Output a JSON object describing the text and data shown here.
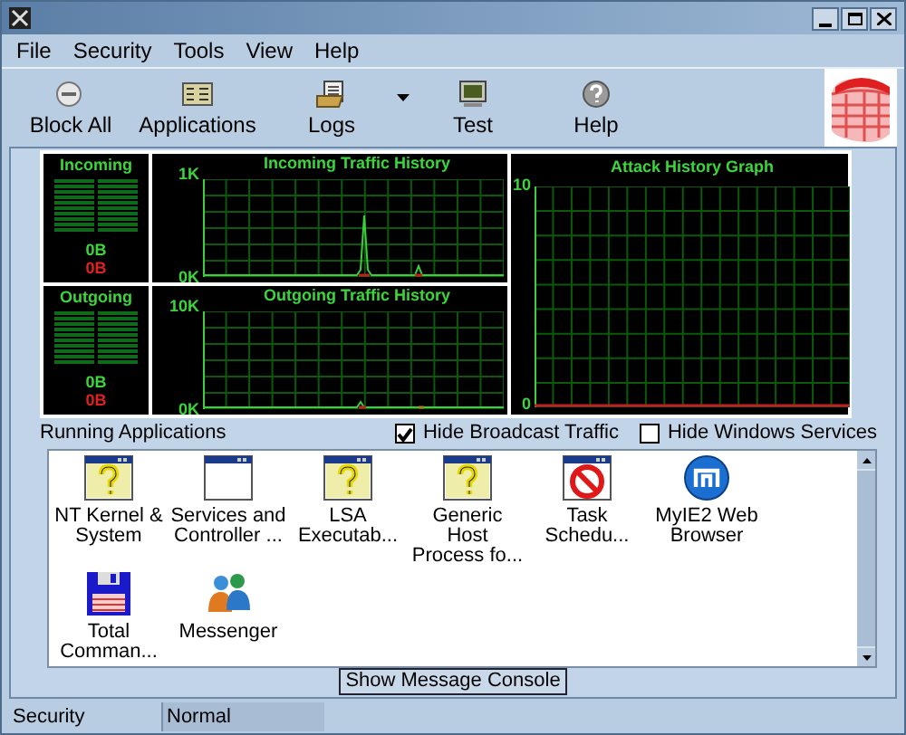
{
  "menu": [
    "File",
    "Security",
    "Tools",
    "View",
    "Help"
  ],
  "toolbar": [
    {
      "label": "Block All",
      "kind": "block",
      "has_menu": false
    },
    {
      "label": "Applications",
      "kind": "apps",
      "has_menu": false
    },
    {
      "label": "Logs",
      "kind": "logs",
      "has_menu": true
    },
    {
      "label": "Test",
      "kind": "test",
      "has_menu": false
    },
    {
      "label": "Help",
      "kind": "help",
      "has_menu": false
    }
  ],
  "meters": [
    {
      "label": "Incoming",
      "received": "0B",
      "sent": "0B"
    },
    {
      "label": "Outgoing",
      "received": "0B",
      "sent": "0B"
    }
  ],
  "traffic_charts": [
    {
      "title": "Incoming Traffic History",
      "y_max": "1K",
      "y_min": "0K",
      "kind": "incoming"
    },
    {
      "title": "Outgoing Traffic History",
      "y_max": "10K",
      "y_min": "0K",
      "kind": "outgoing"
    }
  ],
  "attack_graph": {
    "title": "Attack History Graph",
    "y_max": "10",
    "y_min": "0"
  },
  "running_applications": {
    "title": "Running Applications",
    "apps": [
      {
        "name": "NT Kernel & System",
        "kind": "unknown"
      },
      {
        "name": "Services and Controller ...",
        "kind": "window"
      },
      {
        "name": "LSA Executab...",
        "kind": "unknown"
      },
      {
        "name": "Generic Host Process fo...",
        "kind": "unknown"
      },
      {
        "name": "Task Schedu...",
        "kind": "blocked"
      },
      {
        "name": "MyIE2 Web Browser",
        "kind": "browser"
      },
      {
        "name": "Total Comman...",
        "kind": "floppy"
      },
      {
        "name": "Messenger",
        "kind": "people"
      }
    ]
  },
  "options": [
    {
      "label": "Hide Broadcast Traffic",
      "checked": true
    },
    {
      "label": "Hide Windows Services",
      "checked": false
    }
  ],
  "console_button": "Show Message Console",
  "status_bar": {
    "label": "Security",
    "value": "Normal"
  }
}
